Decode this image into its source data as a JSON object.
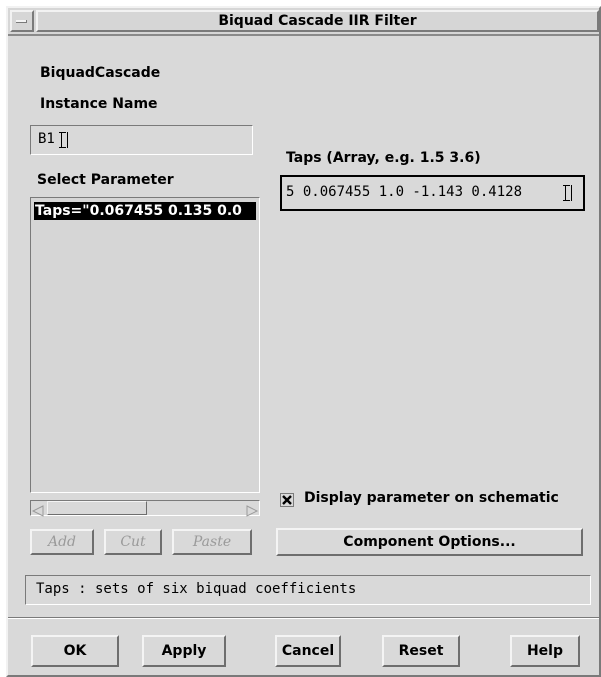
{
  "window": {
    "title": "Biquad Cascade IIR Filter"
  },
  "component": {
    "name": "BiquadCascade"
  },
  "instance": {
    "label": "Instance Name",
    "value": "B1"
  },
  "parameters": {
    "label": "Select Parameter",
    "items": [
      "Taps=\"0.067455 0.135 0.0"
    ]
  },
  "edit_buttons": {
    "add": "Add",
    "cut": "Cut",
    "paste": "Paste"
  },
  "taps": {
    "label": "Taps (Array, e.g. 1.5 3.6)",
    "value": "5 0.067455 1.0 -1.143 0.4128"
  },
  "display_on_schematic": {
    "label": "Display parameter on schematic",
    "checked": true
  },
  "component_options": {
    "label": "Component Options..."
  },
  "status": {
    "text": "Taps : sets of six biquad coefficients"
  },
  "footer": {
    "ok": "OK",
    "apply": "Apply",
    "cancel": "Cancel",
    "reset": "Reset",
    "help": "Help"
  }
}
